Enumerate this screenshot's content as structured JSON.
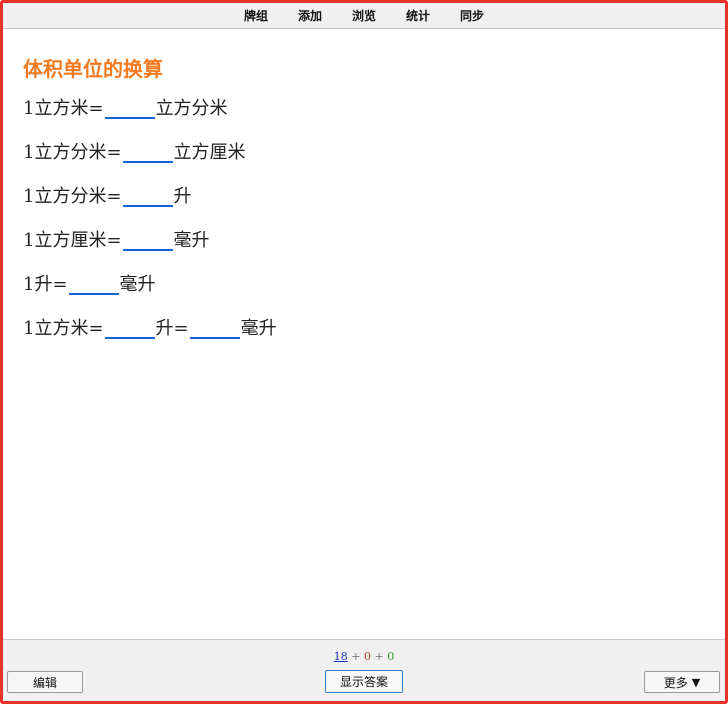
{
  "menu": [
    "牌组",
    "添加",
    "浏览",
    "统计",
    "同步"
  ],
  "card": {
    "title": "体积单位的换算",
    "lines": [
      {
        "parts": [
          "1立方米=",
          "立方分米"
        ]
      },
      {
        "parts": [
          "1立方分米=",
          "立方厘米"
        ]
      },
      {
        "parts": [
          "1立方分米=",
          "升"
        ]
      },
      {
        "parts": [
          "1立方厘米=",
          "毫升"
        ]
      },
      {
        "parts": [
          "1升=",
          "毫升"
        ]
      },
      {
        "parts": [
          "1立方米=",
          "升=",
          "毫升"
        ]
      }
    ]
  },
  "counts": {
    "new": "18",
    "learning": "0",
    "review": "0",
    "separator": "+"
  },
  "buttons": {
    "edit": "编辑",
    "show_answer": "显示答案",
    "more": "更多"
  },
  "colors": {
    "title": "#f47a20",
    "blank_underline": "#1a63d1",
    "frame_border": "#e8332a"
  },
  "icons": {
    "more": "triangle-down-icon"
  }
}
